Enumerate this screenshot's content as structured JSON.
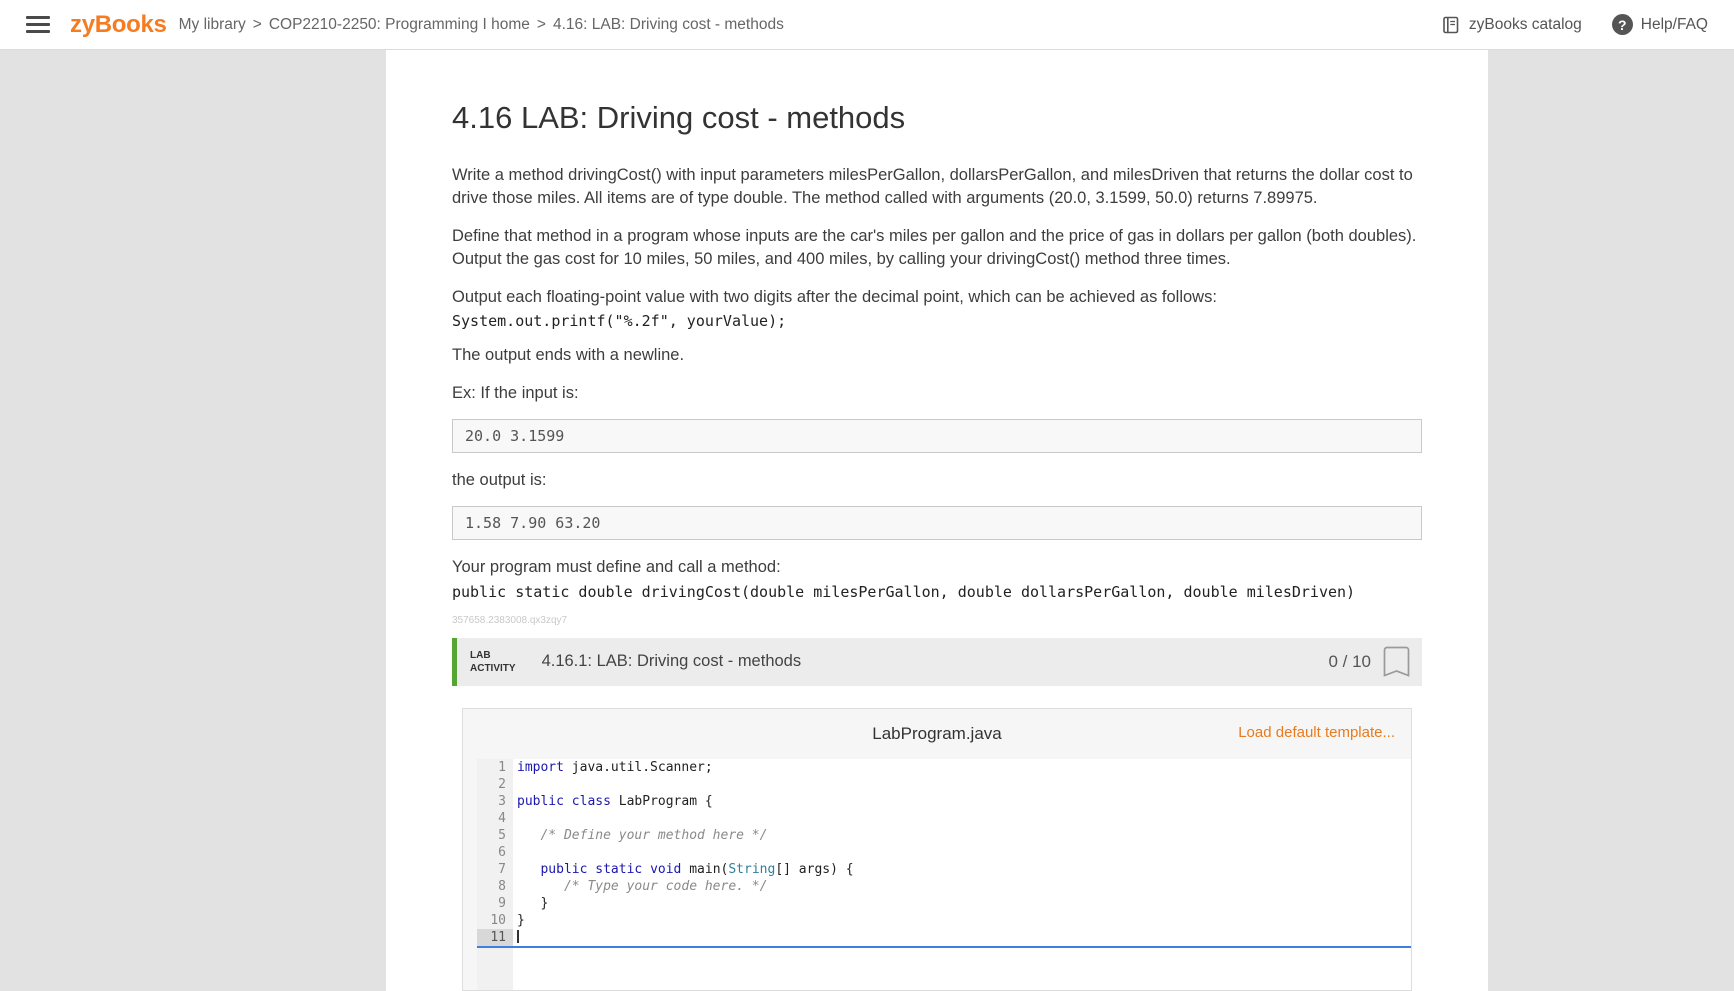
{
  "header": {
    "logo": "zyBooks",
    "breadcrumb": {
      "library": "My library",
      "separator": ">",
      "course": "COP2210-2250: Programming I home",
      "page": "4.16: LAB: Driving cost - methods"
    },
    "catalog_label": "zyBooks catalog",
    "help_label": "Help/FAQ",
    "help_icon_glyph": "?"
  },
  "content": {
    "title": "4.16 LAB: Driving cost - methods",
    "para1": "Write a method drivingCost() with input parameters milesPerGallon, dollarsPerGallon, and milesDriven that returns the dollar cost to drive those miles. All items are of type double. The method called with arguments (20.0, 3.1599, 50.0) returns 7.89975.",
    "para2": "Define that method in a program whose inputs are the car's miles per gallon and the price of gas in dollars per gallon (both doubles). Output the gas cost for 10 miles, 50 miles, and 400 miles, by calling your drivingCost() method three times.",
    "para3": "Output each floating-point value with two digits after the decimal point, which can be achieved as follows:",
    "printf_example": "System.out.printf(\"%.2f\", yourValue);",
    "para4": "The output ends with a newline.",
    "example_input_label": "Ex: If the input is:",
    "example_input": "20.0 3.1599",
    "example_output_label": "the output is:",
    "example_output": "1.58 7.90 63.20",
    "method_requirement_label": "Your program must define and call a method:",
    "method_signature": "public static double drivingCost(double milesPerGallon, double dollarsPerGallon, double milesDriven)",
    "watermark": "357658.2383008.qx3zqy7"
  },
  "lab": {
    "activity_line1": "LAB",
    "activity_line2": "ACTIVITY",
    "title": "4.16.1: LAB: Driving cost - methods",
    "score": "0 / 10"
  },
  "editor": {
    "filename": "LabProgram.java",
    "load_template_label": "Load default template...",
    "code_lines": [
      {
        "n": 1,
        "tokens": [
          {
            "t": "import",
            "c": "kw"
          },
          {
            "t": " java.util.Scanner;",
            "c": "pl"
          }
        ]
      },
      {
        "n": 2,
        "tokens": []
      },
      {
        "n": 3,
        "tokens": [
          {
            "t": "public",
            "c": "kw"
          },
          {
            "t": " ",
            "c": "pl"
          },
          {
            "t": "class",
            "c": "kw"
          },
          {
            "t": " LabProgram {",
            "c": "pl"
          }
        ]
      },
      {
        "n": 4,
        "tokens": []
      },
      {
        "n": 5,
        "tokens": [
          {
            "t": "   ",
            "c": "pl"
          },
          {
            "t": "/* Define your method here */",
            "c": "cm"
          }
        ]
      },
      {
        "n": 6,
        "tokens": []
      },
      {
        "n": 7,
        "tokens": [
          {
            "t": "   ",
            "c": "pl"
          },
          {
            "t": "public",
            "c": "kw"
          },
          {
            "t": " ",
            "c": "pl"
          },
          {
            "t": "static",
            "c": "kw"
          },
          {
            "t": " ",
            "c": "pl"
          },
          {
            "t": "void",
            "c": "kw"
          },
          {
            "t": " main(",
            "c": "pl"
          },
          {
            "t": "String",
            "c": "ty"
          },
          {
            "t": "[] args) {",
            "c": "pl"
          }
        ]
      },
      {
        "n": 8,
        "tokens": [
          {
            "t": "      ",
            "c": "pl"
          },
          {
            "t": "/* Type your code here. */",
            "c": "cm"
          }
        ]
      },
      {
        "n": 9,
        "tokens": [
          {
            "t": "   }",
            "c": "pl"
          }
        ]
      },
      {
        "n": 10,
        "tokens": [
          {
            "t": "}",
            "c": "pl"
          }
        ]
      },
      {
        "n": 11,
        "tokens": [],
        "active": true
      }
    ]
  },
  "colors": {
    "brand_orange": "#f57c20",
    "link_orange": "#e87b1e",
    "lab_green": "#55a532",
    "active_line_blue": "#3f7de0"
  }
}
